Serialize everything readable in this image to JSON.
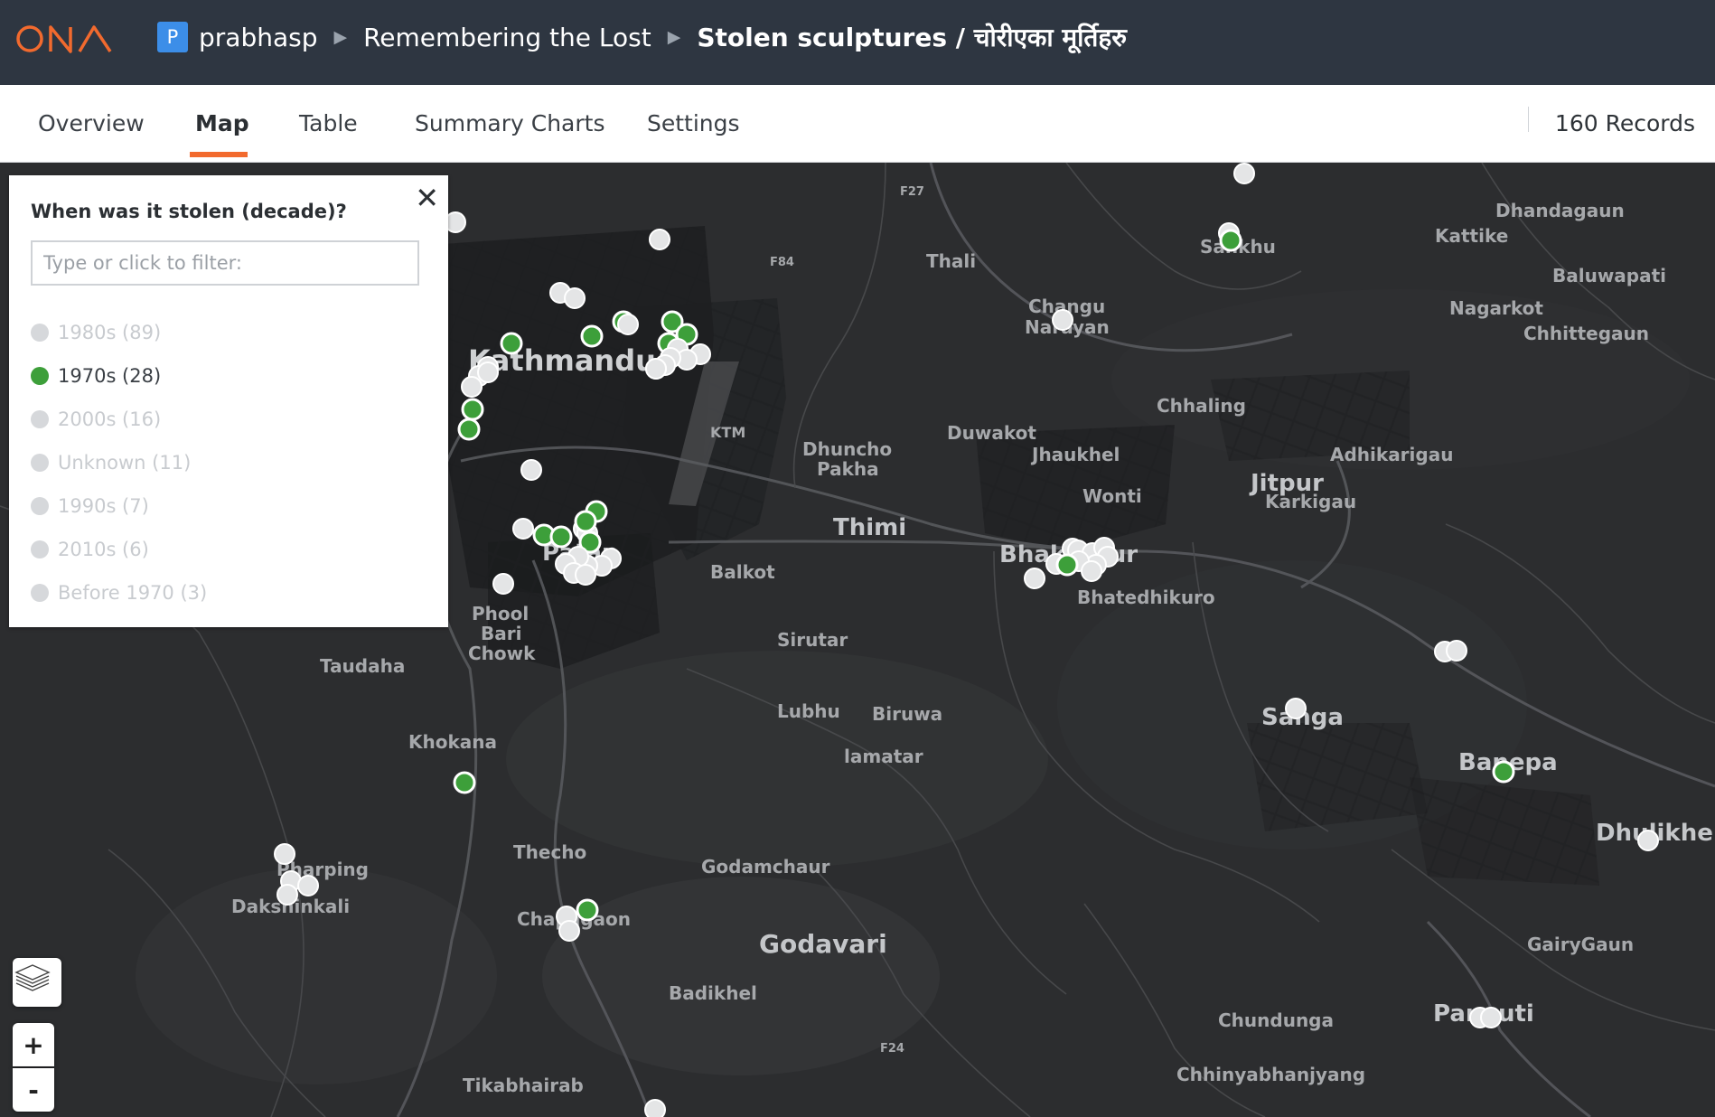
{
  "header": {
    "avatar_letter": "P",
    "breadcrumb": [
      "prabhasp",
      "Remembering the Lost",
      "Stolen sculptures / चोरीएका मूर्तिहरु"
    ]
  },
  "tabs": [
    "Overview",
    "Map",
    "Table",
    "Summary Charts",
    "Settings"
  ],
  "active_tab": "Map",
  "language": "EN",
  "records": "160 Records",
  "legend": {
    "title": "When was it stolen (decade)?",
    "filter_placeholder": "Type or click to filter:",
    "items": [
      {
        "label": "1980s (89)",
        "active": false
      },
      {
        "label": "1970s (28)",
        "active": true
      },
      {
        "label": "2000s (16)",
        "active": false
      },
      {
        "label": "Unknown (11)",
        "active": false
      },
      {
        "label": "1990s (7)",
        "active": false
      },
      {
        "label": "2010s (6)",
        "active": false
      },
      {
        "label": "Before 1970 (3)",
        "active": false
      }
    ]
  },
  "controls": {
    "zoom_in": "+",
    "zoom_out": "-",
    "layers_icon": "layers-icon"
  },
  "map_labels": {
    "kathmandu": "Kathmandu",
    "thali": "Thali",
    "changu": "Changu",
    "narayan": "Narayan",
    "sankhu": "Sankhu",
    "dhandagaun": "Dhandagaun",
    "kattike": "Kattike",
    "baluwapati": "Baluwapati",
    "nagarkot": "Nagarkot",
    "chhittegaun": "Chhittegaun",
    "chhaling": "Chhaling",
    "adhikarigau": "Adhikarigau",
    "jitpur": "Jitpur",
    "karkigau": "Karkigau",
    "duwakot": "Duwakot",
    "jhaukhel": "Jhaukhel",
    "wonti": "Wonti",
    "dhuncho": "Dhuncho",
    "pakha": "Pakha",
    "ktm": "KTM",
    "thimi": "Thimi",
    "balkot": "Balkot",
    "bhaktapur": "Bhaktapur",
    "bhatedhikuro": "Bhatedhikuro",
    "patan": "Patan",
    "phool": "Phool",
    "bari": "Bari",
    "chowk": "Chowk",
    "taudaha": "Taudaha",
    "sirutar": "Sirutar",
    "lubhu": "Lubhu",
    "biruwa": "Biruwa",
    "lamatar": "lamatar",
    "khokana": "Khokana",
    "sanga": "Sanga",
    "banepa": "Banepa",
    "dhulikhel": "Dhulikhel",
    "pharping": "Pharping",
    "dakshinkali": "Dakshinkali",
    "thecho": "Thecho",
    "godamchaur": "Godamchaur",
    "chapagaon": "Chapagaon",
    "godavari": "Godavari",
    "gairygaun": "GairyGaun",
    "badikhel": "Badikhel",
    "chundunga": "Chundunga",
    "panauti": "Panauti",
    "chhinyabhanjyang": "Chhinyabhanjyang",
    "tikabhairab": "Tikabhairab",
    "f84": "F84",
    "f24": "F24",
    "f27": "F27"
  },
  "colors": {
    "header_bg": "#2e3641",
    "accent": "#f26a2e",
    "active_dot": "#3d9f3a",
    "inactive_dot": "#e4e5e6",
    "map_bg": "#2c2d2f"
  }
}
